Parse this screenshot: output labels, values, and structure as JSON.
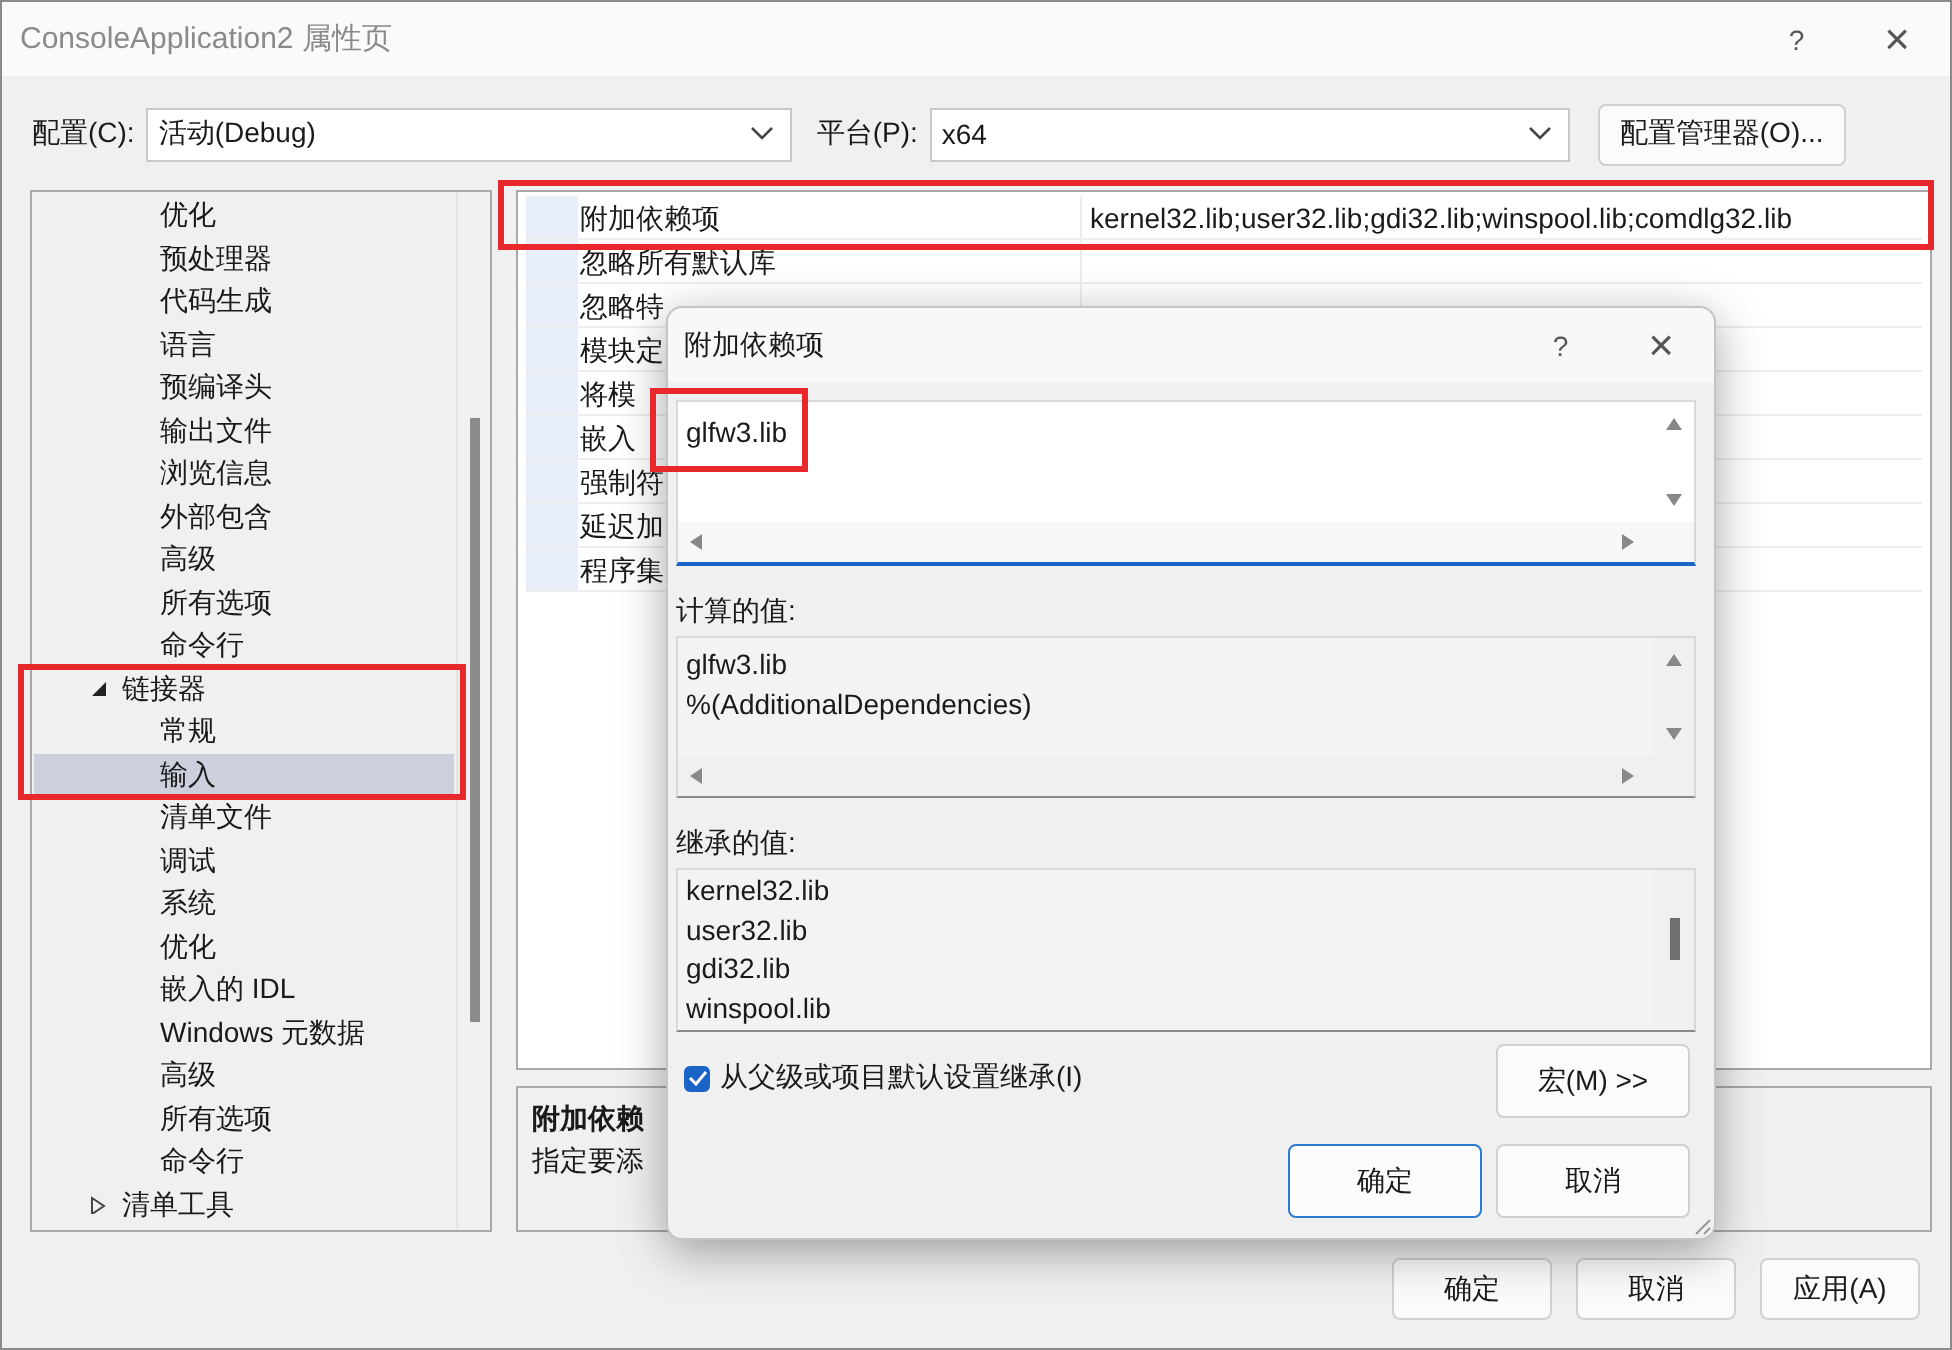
{
  "window": {
    "title": "ConsoleApplication2 属性页",
    "help": "?",
    "close": "×"
  },
  "config_row": {
    "config_label": "配置(C):",
    "config_value": "活动(Debug)",
    "platform_label": "平台(P):",
    "platform_value": "x64",
    "manager_button": "配置管理器(O)..."
  },
  "tree": {
    "items": [
      {
        "children": [
          {
            "label": "优化",
            "selected": false,
            "highlighted": false
          },
          {
            "label": "预处理器",
            "selected": false,
            "highlighted": false
          },
          {
            "label": "代码生成",
            "selected": false,
            "highlighted": false
          },
          {
            "label": "语言",
            "selected": false,
            "highlighted": false
          },
          {
            "label": "预编译头",
            "selected": false,
            "highlighted": false
          },
          {
            "label": "输出文件",
            "selected": false,
            "highlighted": false
          },
          {
            "label": "浏览信息",
            "selected": false,
            "highlighted": false
          },
          {
            "label": "外部包含",
            "selected": false,
            "highlighted": false
          },
          {
            "label": "高级",
            "selected": false,
            "highlighted": false
          },
          {
            "label": "所有选项",
            "selected": false,
            "highlighted": false
          },
          {
            "label": "命令行",
            "selected": false,
            "highlighted": false
          }
        ]
      },
      {
        "label": "链接器",
        "expanded": true,
        "selected": false,
        "highlighted": true,
        "children": [
          {
            "label": "常规",
            "selected": false,
            "highlighted": true
          },
          {
            "label": "输入",
            "selected": true,
            "highlighted": true
          },
          {
            "label": "清单文件",
            "selected": false,
            "highlighted": false
          },
          {
            "label": "调试",
            "selected": false,
            "highlighted": false
          },
          {
            "label": "系统",
            "selected": false,
            "highlighted": false
          },
          {
            "label": "优化",
            "selected": false,
            "highlighted": false
          },
          {
            "label": "嵌入的 IDL",
            "selected": false,
            "highlighted": false
          },
          {
            "label": "Windows 元数据",
            "selected": false,
            "highlighted": false
          },
          {
            "label": "高级",
            "selected": false,
            "highlighted": false
          },
          {
            "label": "所有选项",
            "selected": false,
            "highlighted": false
          },
          {
            "label": "命令行",
            "selected": false,
            "highlighted": false
          }
        ]
      },
      {
        "label": "清单工具",
        "expanded": false,
        "selected": false,
        "highlighted": false
      }
    ]
  },
  "properties": [
    {
      "name": "附加依赖项",
      "value": "kernel32.lib;user32.lib;gdi32.lib;winspool.lib;comdlg32.lib",
      "highlighted": true
    },
    {
      "name": "忽略所有默认库",
      "highlighted": false
    },
    {
      "name": "忽略特",
      "highlighted": false
    },
    {
      "name": "模块定",
      "highlighted": false
    },
    {
      "name": "将模",
      "highlighted": false
    },
    {
      "name": "嵌入",
      "highlighted": false
    },
    {
      "name": "强制符",
      "highlighted": false
    },
    {
      "name": "延迟加",
      "highlighted": false
    },
    {
      "name": "程序集",
      "highlighted": false
    }
  ],
  "description": {
    "title": "附加依赖",
    "text": "指定要添"
  },
  "buttons": [
    "确定",
    "取消",
    "应用(A)"
  ],
  "dialog": {
    "title": "附加依赖项",
    "help": "?",
    "close": "×",
    "edit": {
      "value": "glfw3.lib",
      "highlighted": true
    },
    "computed_label": "计算的值:",
    "computed_lines": [
      "glfw3.lib",
      "%(AdditionalDependencies)"
    ],
    "inherited_label": "继承的值:",
    "inherited_lines": [
      "kernel32.lib",
      "user32.lib",
      "gdi32.lib",
      "winspool.lib"
    ],
    "inherit_checkbox": {
      "label": "从父级或项目默认设置继承(I)",
      "checked": true
    },
    "macro_button": "宏(M) >>",
    "buttons": [
      "确定",
      "取消"
    ]
  }
}
